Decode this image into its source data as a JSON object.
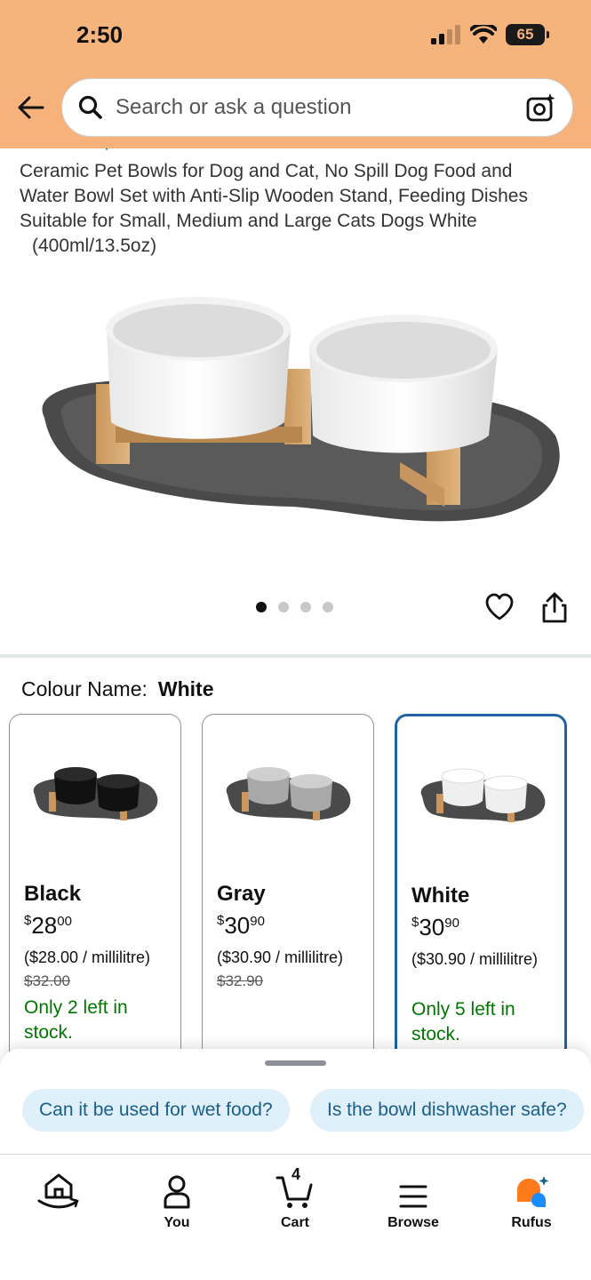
{
  "status_bar": {
    "time": "2:50",
    "battery": "65"
  },
  "search": {
    "placeholder": "Search or ask a question"
  },
  "product": {
    "brand_partial": "Brand: Intipaetin",
    "title": "Ceramic Pet Bowls for Dog and Cat, No Spill Dog Food and Water Bowl Set with Anti-Slip Wooden Stand, Feeding Dishes Suitable for Small, Medium and Large Cats Dogs White",
    "size": "(400ml/13.5oz)",
    "image_count": 4,
    "active_image": 1
  },
  "colour": {
    "label": "Colour Name:",
    "selected": "White",
    "variants": [
      {
        "name": "Black",
        "currency": "$",
        "price_whole": "28",
        "price_cents": "00",
        "unit_price": "($28.00 / millilitre)",
        "was_price": "$32.00",
        "stock": "Only 2 left in stock."
      },
      {
        "name": "Gray",
        "currency": "$",
        "price_whole": "30",
        "price_cents": "90",
        "unit_price": "($30.90 / millilitre)",
        "was_price": "$32.90",
        "stock": ""
      },
      {
        "name": "White",
        "currency": "$",
        "price_whole": "30",
        "price_cents": "90",
        "unit_price": "($30.90 / millilitre)",
        "was_price": "",
        "stock": "Only 5 left in stock."
      }
    ]
  },
  "suggestions": [
    "Can it be used for wet food?",
    "Is the bowl dishwasher safe?"
  ],
  "nav": {
    "home": "",
    "you": "You",
    "cart": "Cart",
    "cart_count": "4",
    "browse": "Browse",
    "rufus": "Rufus"
  },
  "colors": {
    "header": "#f4b47c",
    "link": "#007185",
    "stock": "#007600",
    "selected_border": "#2162a1",
    "chip_bg": "#dff0fa"
  }
}
